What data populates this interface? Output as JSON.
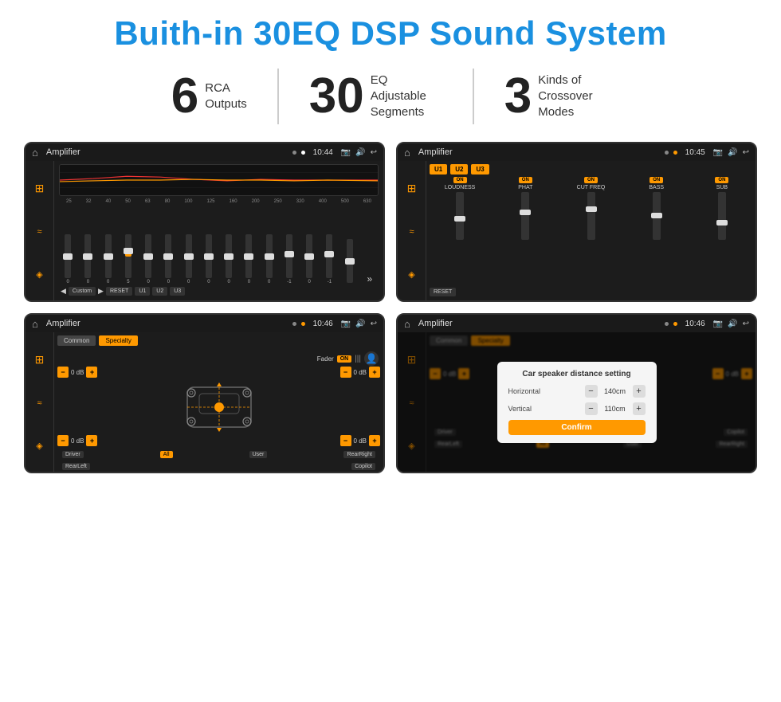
{
  "page": {
    "title": "Buith-in 30EQ DSP Sound System",
    "stats": [
      {
        "number": "6",
        "label": "RCA\nOutputs"
      },
      {
        "number": "30",
        "label": "EQ Adjustable\nSegments"
      },
      {
        "number": "3",
        "label": "Kinds of\nCrossover Modes"
      }
    ],
    "screens": [
      {
        "id": "screen-eq",
        "status_bar": {
          "title": "Amplifier",
          "time": "10:44"
        },
        "type": "equalizer"
      },
      {
        "id": "screen-amp",
        "status_bar": {
          "title": "Amplifier",
          "time": "10:45"
        },
        "type": "amplifier"
      },
      {
        "id": "screen-fader",
        "status_bar": {
          "title": "Amplifier",
          "time": "10:46"
        },
        "type": "fader"
      },
      {
        "id": "screen-dialog",
        "status_bar": {
          "title": "Amplifier",
          "time": "10:46"
        },
        "type": "dialog"
      }
    ],
    "eq_screen": {
      "frequencies": [
        "25",
        "32",
        "40",
        "50",
        "63",
        "80",
        "100",
        "125",
        "160",
        "200",
        "250",
        "320",
        "400",
        "500",
        "630"
      ],
      "values": [
        "0",
        "0",
        "0",
        "5",
        "0",
        "0",
        "0",
        "0",
        "0",
        "0",
        "0",
        "-1",
        "0",
        "-1",
        ""
      ],
      "presets": [
        "Custom",
        "RESET",
        "U1",
        "U2",
        "U3"
      ]
    },
    "amp_screen": {
      "presets": [
        "U1",
        "U2",
        "U3"
      ],
      "channels": [
        {
          "label": "LOUDNESS",
          "on": true
        },
        {
          "label": "PHAT",
          "on": true
        },
        {
          "label": "CUT FREQ",
          "on": true
        },
        {
          "label": "BASS",
          "on": true
        },
        {
          "label": "SUB",
          "on": true
        }
      ],
      "reset_label": "RESET"
    },
    "fader_screen": {
      "tabs": [
        "Common",
        "Specialty"
      ],
      "fader_label": "Fader",
      "on_text": "ON",
      "db_controls": [
        {
          "value": "0 dB"
        },
        {
          "value": "0 dB"
        },
        {
          "value": "0 dB"
        },
        {
          "value": "0 dB"
        }
      ],
      "bottom_labels": [
        "Driver",
        "All",
        "User",
        "RearRight",
        "RearLeft",
        "Copilot"
      ]
    },
    "dialog_screen": {
      "tabs": [
        "Common",
        "Specialty"
      ],
      "dialog_title": "Car speaker distance setting",
      "fields": [
        {
          "label": "Horizontal",
          "value": "140cm"
        },
        {
          "label": "Vertical",
          "value": "110cm"
        }
      ],
      "confirm_label": "Confirm",
      "db_right": [
        "0 dB",
        "0 dB"
      ],
      "bottom_labels": [
        "Driver",
        "Copilot",
        "RearLeft",
        "All",
        "User",
        "RearRight"
      ]
    }
  }
}
